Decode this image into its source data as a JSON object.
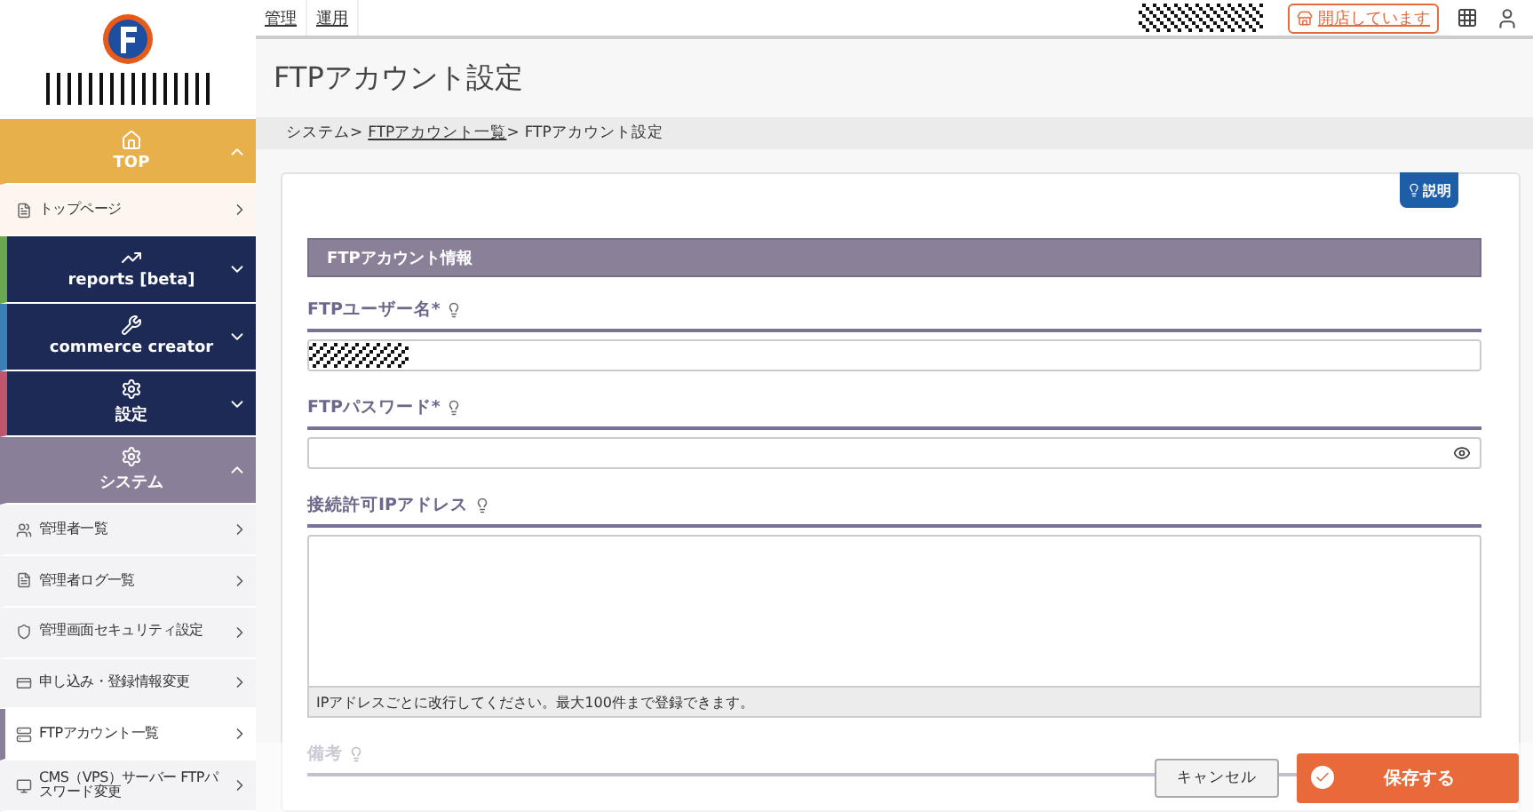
{
  "top_bar": {
    "links": [
      "管理",
      "運用"
    ],
    "store_status": "開店しています"
  },
  "sidebar": {
    "items": [
      {
        "label": "TOP",
        "expanded": true,
        "color": "#e8b04a",
        "children": [
          {
            "label": "トップページ",
            "selected": false
          }
        ]
      },
      {
        "label": "reports [beta]",
        "expanded": false,
        "color": "#6aa84f"
      },
      {
        "label": "commerce creator",
        "expanded": false,
        "color": "#3a7fb5"
      },
      {
        "label": "設定",
        "expanded": false,
        "color": "#c0566e"
      },
      {
        "label": "システム",
        "expanded": true,
        "color": "#8a7f99",
        "children": [
          {
            "label": "管理者一覧",
            "selected": false
          },
          {
            "label": "管理者ログ一覧",
            "selected": false
          },
          {
            "label": "管理画面セキュリティ設定",
            "selected": false
          },
          {
            "label": "申し込み・登録情報変更",
            "selected": false
          },
          {
            "label": "FTPアカウント一覧",
            "selected": true
          },
          {
            "label": "CMS（VPS）サーバー FTPパスワード変更",
            "selected": false
          }
        ]
      }
    ]
  },
  "page": {
    "title": "FTPアカウント設定",
    "breadcrumb_separator": ">",
    "breadcrumb": [
      {
        "label": "システム",
        "link": false
      },
      {
        "label": "FTPアカウント一覧",
        "link": true
      },
      {
        "label": "FTPアカウント設定",
        "link": false
      }
    ]
  },
  "help_badge": "説明",
  "form": {
    "section_title": "FTPアカウント情報",
    "fields": [
      {
        "kind": "text",
        "label": "FTPユーザー名*"
      },
      {
        "kind": "password",
        "label": "FTPパスワード*"
      },
      {
        "kind": "textarea",
        "label": "接続許可IPアドレス",
        "note": "IPアドレスごとに改行してください。最大100件まで登録できます。"
      },
      {
        "kind": "faded",
        "label": "備考"
      }
    ]
  },
  "footer": {
    "cancel": "キャンセル",
    "save": "保存する"
  }
}
